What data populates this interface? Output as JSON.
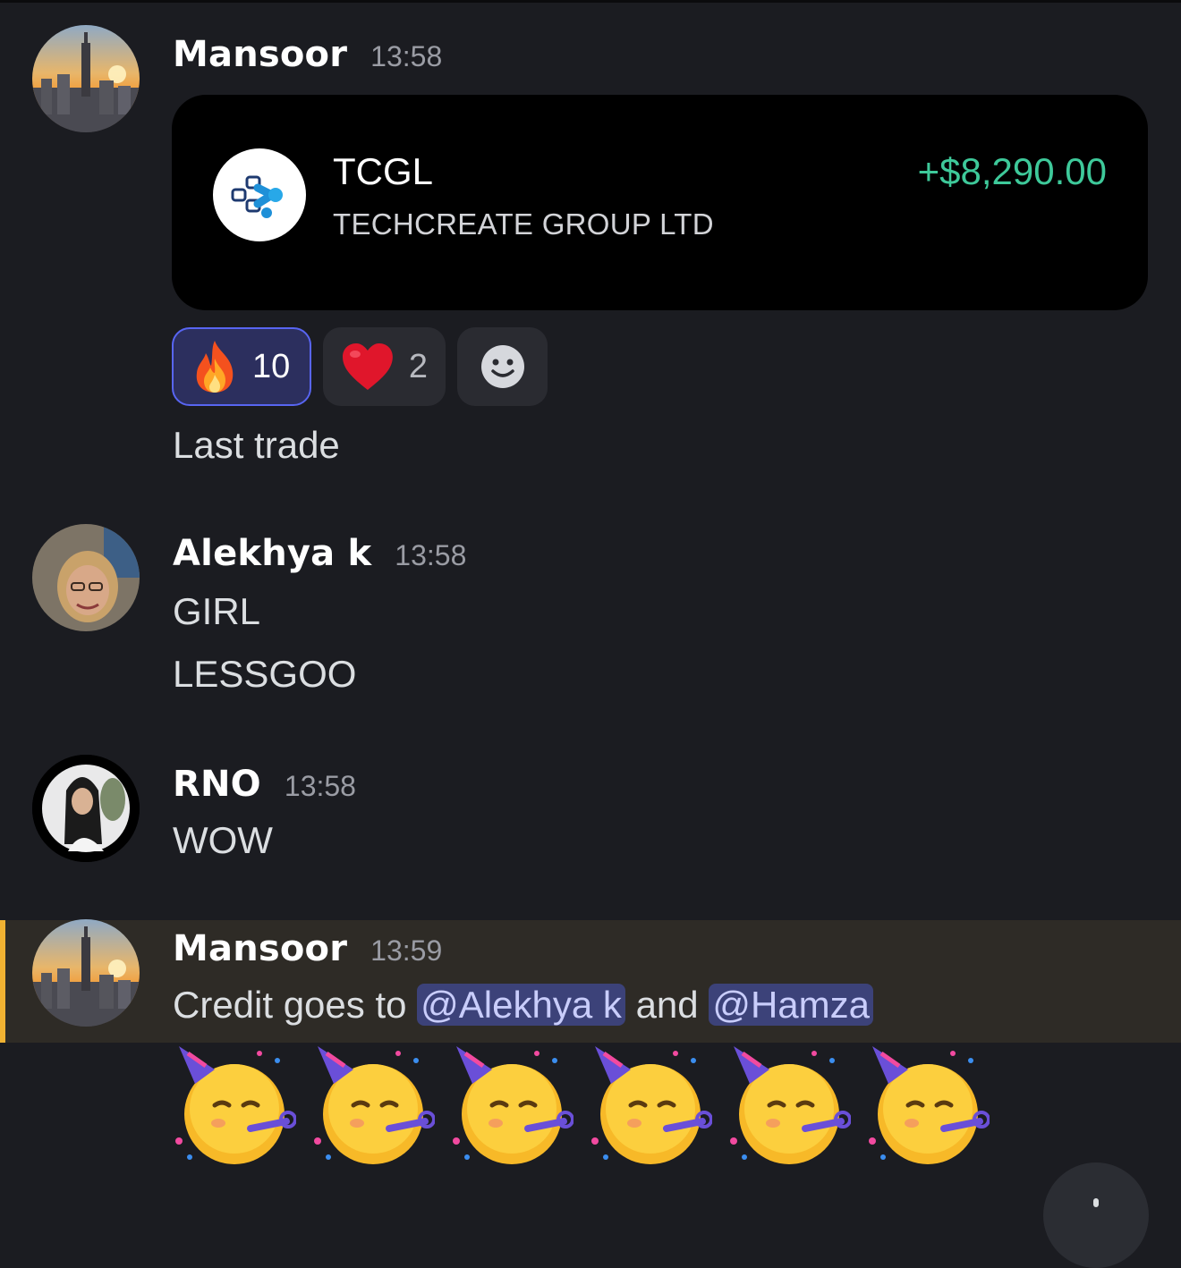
{
  "messages": [
    {
      "username": "Mansoor",
      "time": "13:58",
      "avatar": "city-sunset-avatar",
      "trade": {
        "ticker": "TCGL",
        "company": "TECHCREATE GROUP LTD",
        "gain": "+$8,290.00",
        "gain_color": "#3ec99a"
      },
      "reactions": [
        {
          "emoji": "fire",
          "count": "10",
          "active": true
        },
        {
          "emoji": "heart",
          "count": "2",
          "active": false
        },
        {
          "emoji": "add-reaction",
          "count": "",
          "active": false
        }
      ],
      "text": "Last trade"
    },
    {
      "username": "Alekhya k",
      "time": "13:58",
      "avatar": "portrait-avatar",
      "lines": [
        "GIRL",
        "LESSGOO"
      ]
    },
    {
      "username": "RNO",
      "time": "13:58",
      "avatar": "portrait-avatar-dark",
      "lines": [
        "WOW"
      ]
    },
    {
      "username": "Mansoor",
      "time": "13:59",
      "avatar": "city-sunset-avatar",
      "highlighted": true,
      "text_prefix": "Credit goes to",
      "mention_1": "@Alekhya k",
      "text_join": "and",
      "mention_2": "@Hamza",
      "emoji_row": [
        "partying-face",
        "partying-face",
        "partying-face",
        "partying-face",
        "partying-face",
        "partying-face"
      ]
    }
  ],
  "colors": {
    "background": "#1b1c21",
    "mention_bg": "#3c4279",
    "highlight_bar": "#f0b232",
    "reaction_active_border": "#5865f2"
  }
}
